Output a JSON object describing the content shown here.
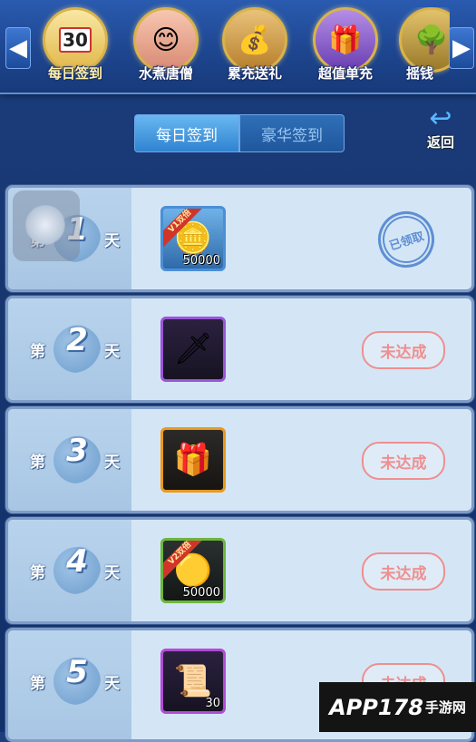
{
  "topbar": {
    "events": [
      {
        "label": "每日签到",
        "icon": "calendar-icon",
        "glyph": "📅",
        "badge": "30",
        "active": true
      },
      {
        "label": "水煮唐僧",
        "icon": "monk-character-icon",
        "glyph": "😊"
      },
      {
        "label": "累充送礼",
        "icon": "treasure-chest-icon",
        "glyph": "💰"
      },
      {
        "label": "超值单充",
        "icon": "gift-box-icon",
        "glyph": "🎁"
      },
      {
        "label": "摇钱",
        "icon": "money-tree-icon",
        "glyph": "🌳"
      }
    ],
    "left_arrow": "◀",
    "right_arrow": "▶"
  },
  "tabs": [
    {
      "label": "每日签到",
      "active": true
    },
    {
      "label": "豪华签到",
      "active": false
    }
  ],
  "back": {
    "label": "返回",
    "arrow": "↩"
  },
  "rows": [
    {
      "prefix": "第",
      "num": "1",
      "suffix": "天",
      "item_icon": "silver-ingots-icon",
      "item_glyph": "🪙",
      "quantity": "50000",
      "ribbon": "V1双倍",
      "status": "已领取",
      "claimed": true
    },
    {
      "prefix": "第",
      "num": "2",
      "suffix": "天",
      "item_icon": "spear-weapon-icon",
      "item_glyph": "🗡",
      "quantity": "",
      "ribbon": "",
      "status": "未达成",
      "claimed": false
    },
    {
      "prefix": "第",
      "num": "3",
      "suffix": "天",
      "item_icon": "gift-box-icon",
      "item_glyph": "🎁",
      "quantity": "",
      "ribbon": "",
      "status": "未达成",
      "claimed": false
    },
    {
      "prefix": "第",
      "num": "4",
      "suffix": "天",
      "item_icon": "gold-ingot-icon",
      "item_glyph": "🟡",
      "quantity": "50000",
      "ribbon": "V2双倍",
      "status": "未达成",
      "claimed": false
    },
    {
      "prefix": "第",
      "num": "5",
      "suffix": "天",
      "item_icon": "scroll-card-icon",
      "item_glyph": "📜",
      "quantity": "30",
      "ribbon": "",
      "status": "未达成",
      "claimed": false
    }
  ],
  "watermark": {
    "main": "APP178",
    "sub": "手游网"
  }
}
